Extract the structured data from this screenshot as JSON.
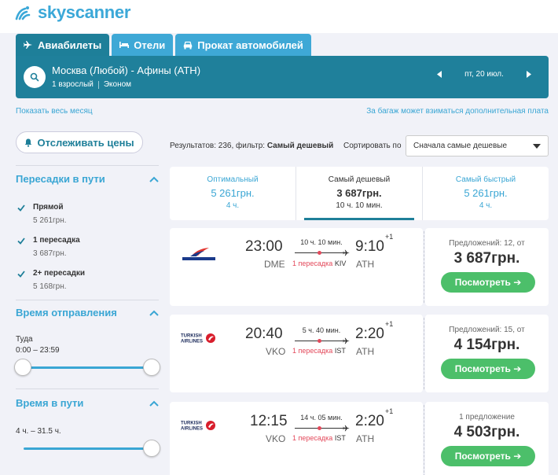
{
  "brand": {
    "name": "skyscanner"
  },
  "tabs": [
    {
      "label": "Авиабилеты",
      "icon": "plane-icon",
      "active": true
    },
    {
      "label": "Отели",
      "icon": "bed-icon",
      "active": false
    },
    {
      "label": "Прокат автомобилей",
      "icon": "car-icon",
      "active": false
    }
  ],
  "search": {
    "route": "Москва (Любой) - Афины (ATH)",
    "passengers": "1 взрослый",
    "cabin": "Эконом",
    "date": "пт, 20 июл."
  },
  "links": {
    "whole_month": "Показать весь месяц",
    "baggage": "За багаж может взиматься дополнительная плата"
  },
  "sidebar": {
    "track_prices": "Отслеживать цены",
    "stops": {
      "title": "Пересадки в пути",
      "items": [
        {
          "label": "Прямой",
          "price": "5 261грн."
        },
        {
          "label": "1 пересадка",
          "price": "3 687грн."
        },
        {
          "label": "2+ пересадки",
          "price": "5 168грн."
        }
      ]
    },
    "departure": {
      "title": "Время отправления",
      "direction": "Туда",
      "range": "0:00 – 23:59",
      "slider_min": 0.0,
      "slider_max": 1.0
    },
    "duration": {
      "title": "Время в пути",
      "range": "4 ч. – 31.5 ч.",
      "slider_max": 1.0
    }
  },
  "results": {
    "prefix": "Результатов: 236, фильтр:",
    "filter": "Самый дешевый",
    "sort_label": "Сортировать по",
    "sort_value": "Сначала самые дешевые"
  },
  "sort_tabs": [
    {
      "title": "Оптимальный",
      "price": "5 261грн.",
      "duration": "4 ч."
    },
    {
      "title": "Самый дешевый",
      "price": "3 687грн.",
      "duration": "10 ч. 10 мин."
    },
    {
      "title": "Самый быстрый",
      "price": "5 261грн.",
      "duration": "4 ч."
    }
  ],
  "flights": [
    {
      "airline": "AIR MOLDOVA",
      "dep_time": "23:00",
      "dep_code": "DME",
      "arr_time": "9:10",
      "day_offset": "+1",
      "arr_code": "ATH",
      "duration": "10 ч. 10 мин.",
      "stops": "1 пересадка",
      "via": "KIV",
      "offers": "Предложений: 12, от",
      "price": "3 687грн.",
      "button": "Посмотреть"
    },
    {
      "airline": "TURKISH AIRLINES",
      "dep_time": "20:40",
      "dep_code": "VKO",
      "arr_time": "2:20",
      "day_offset": "+1",
      "arr_code": "ATH",
      "duration": "5 ч. 40 мин.",
      "stops": "1 пересадка",
      "via": "IST",
      "offers": "Предложений: 15, от",
      "price": "4 154грн.",
      "button": "Посмотреть"
    },
    {
      "airline": "TURKISH AIRLINES",
      "dep_time": "12:15",
      "dep_code": "VKO",
      "arr_time": "2:20",
      "day_offset": "+1",
      "arr_code": "ATH",
      "duration": "14 ч. 05 мин.",
      "stops": "1 пересадка",
      "via": "IST",
      "offers": "1 предложение",
      "price": "4 503грн.",
      "button": "Посмотреть"
    }
  ],
  "colors": {
    "brand": "#3ba8d8",
    "searchbar": "#1f809b",
    "accent": "#3aa6d4",
    "cta": "#4cbf6a",
    "stop_red": "#e3485a"
  }
}
